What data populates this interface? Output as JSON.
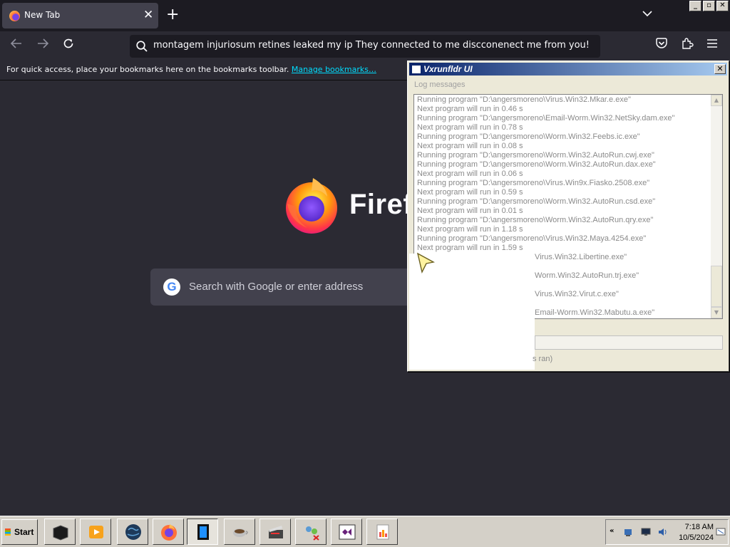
{
  "browser": {
    "tab_title": "New Tab",
    "tab_close": "✕",
    "new_tab": "+",
    "url_text": "montagem injuriosum retines leaked my ip They connected to me discconenect me from you!",
    "bookmarks_hint": "For quick access, place your bookmarks here on the bookmarks toolbar.",
    "bookmarks_link": "Manage bookmarks…",
    "wordmark": "Firef",
    "search_placeholder": "Search with Google or enter address",
    "google_letter": "G"
  },
  "window_controls": {
    "minimize": "_",
    "maximize": "▫",
    "close": "✕"
  },
  "dialog": {
    "title": "Vxrunfldr UI",
    "close": "✕",
    "group_label": "Log messages",
    "log_lines": [
      "Running program \"D:\\angersmoreno\\Virus.Win32.Mkar.e.exe\"",
      "Next program will run in 0.46 s",
      "Running program \"D:\\angersmoreno\\Email-Worm.Win32.NetSky.dam.exe\"",
      "Next program will run in 0.78 s",
      "Running program \"D:\\angersmoreno\\Worm.Win32.Feebs.ic.exe\"",
      "Next program will run in 0.08 s",
      "Running program \"D:\\angersmoreno\\Worm.Win32.AutoRun.cwj.exe\"",
      "Running program \"D:\\angersmoreno\\Worm.Win32.AutoRun.dax.exe\"",
      "Next program will run in 0.06 s",
      "Running program \"D:\\angersmoreno\\Virus.Win9x.Fiasko.2508.exe\"",
      "Next program will run in 0.59 s",
      "Running program \"D:\\angersmoreno\\Worm.Win32.AutoRun.csd.exe\"",
      "Next program will run in 0.01 s",
      "Running program \"D:\\angersmoreno\\Worm.Win32.AutoRun.qry.exe\"",
      "Next program will run in 1.18 s",
      "Running program \"D:\\angersmoreno\\Virus.Win32.Maya.4254.exe\"",
      "Next program will run in 1.59 s",
      "\\Virus.Win32.Libertine.exe\"",
      "",
      "\\Worm.Win32.AutoRun.trj.exe\"",
      "",
      "\\Virus.Win32.Virut.c.exe\"",
      "",
      "\\Email-Worm.Win32.Mabutu.a.exe\""
    ],
    "status_text": "s ran)"
  },
  "taskbar": {
    "start_label": "Start",
    "time": "7:18 AM",
    "date": "10/5/2024",
    "tray_chevron": "«"
  }
}
